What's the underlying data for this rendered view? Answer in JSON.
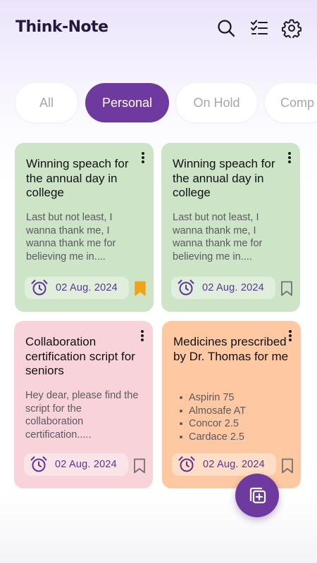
{
  "app": {
    "title": "Think-Note"
  },
  "header_icons": [
    "search-icon",
    "checklist-icon",
    "gear-icon"
  ],
  "filters": [
    {
      "label": "All",
      "active": false
    },
    {
      "label": "Personal",
      "active": true
    },
    {
      "label": "On Hold",
      "active": false
    },
    {
      "label": "Comp",
      "active": false
    }
  ],
  "notes": [
    {
      "title": "Winning speach for the annual day in college",
      "body": "Last but not least, I wanna thank me, I wanna thank me for believing me in....",
      "date": "02 Aug. 2024",
      "bookmarked": true,
      "color": "#cde5c6"
    },
    {
      "title": "Winning speach for the annual day in college",
      "body": "Last but not least, I wanna thank me, I wanna thank me for believing me in....",
      "date": "02 Aug. 2024",
      "bookmarked": false,
      "color": "#cde5c6"
    },
    {
      "title": "Collaboration certification script for seniors",
      "body": "Hey dear, please find the script for the collaboration certification.....",
      "date": "02 Aug. 2024",
      "bookmarked": false,
      "color": "#f9d3da"
    },
    {
      "title": "Medicines prescribed by Dr. Thomas for me",
      "items": [
        "Aspirin 75",
        "Almosafe AT",
        "Concor 2.5",
        "Cardace 2.5"
      ],
      "date": "02 Aug. 2024",
      "bookmarked": false,
      "color": "#fec8a3"
    }
  ],
  "colors": {
    "accent": "#6f3aa0",
    "bookmark_active": "#f0a21a",
    "date_text": "#5b3496"
  },
  "fab": {
    "icon": "add-note-icon"
  }
}
